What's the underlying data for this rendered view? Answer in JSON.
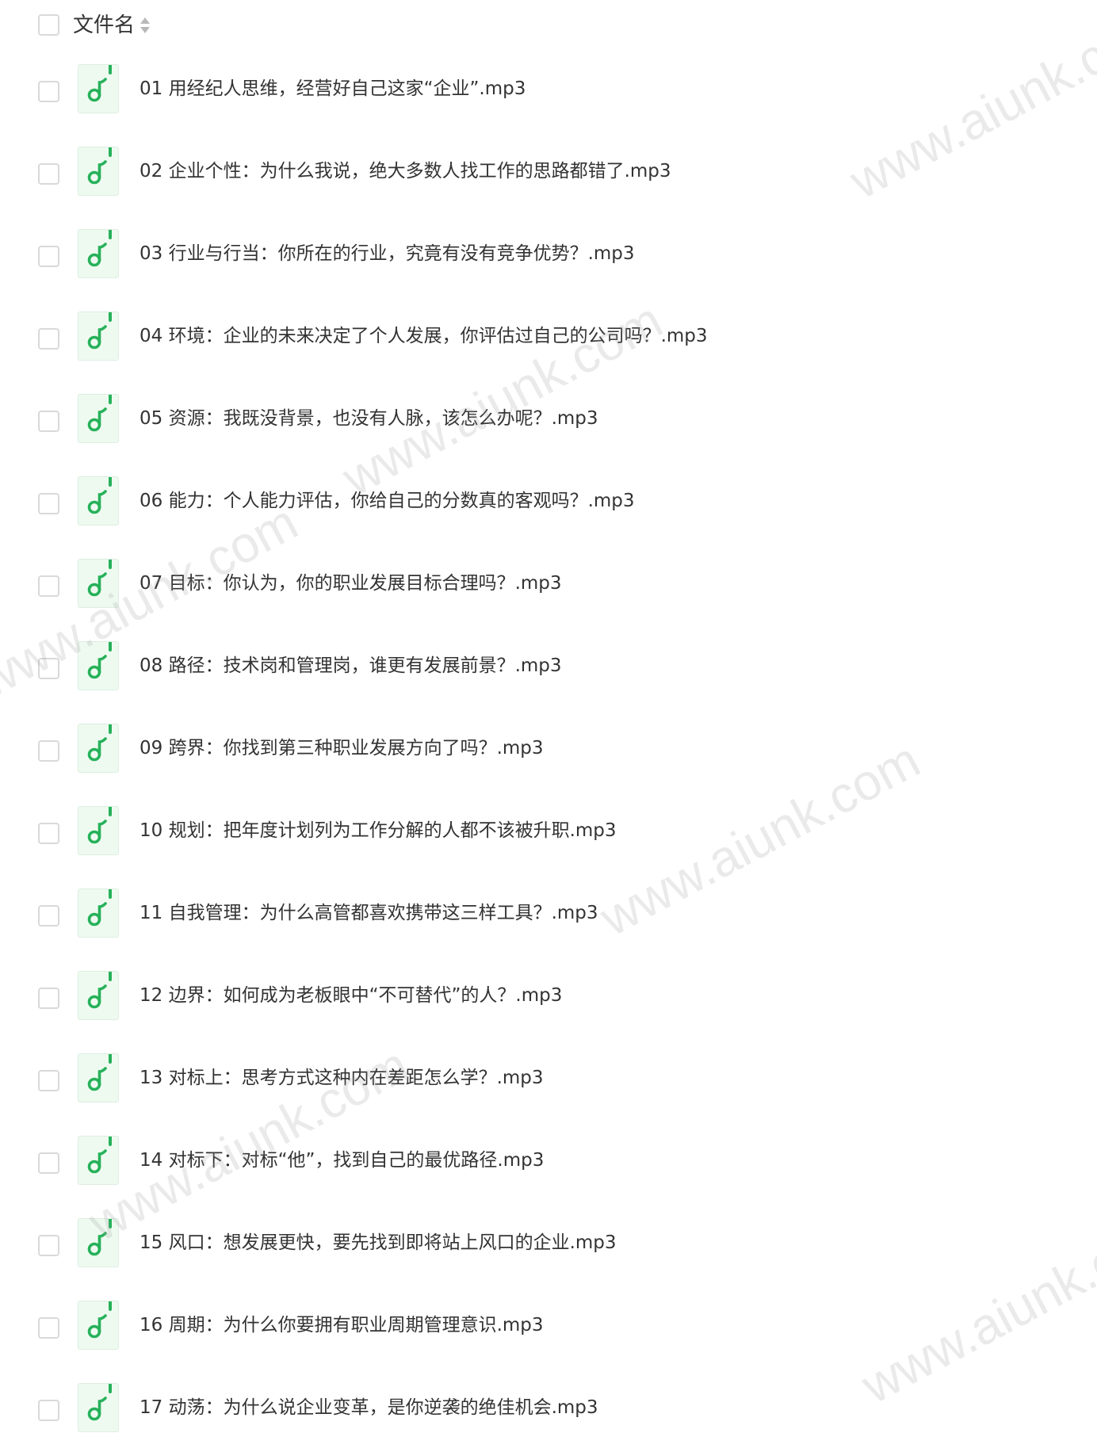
{
  "header": {
    "column_label": "文件名",
    "sort_icon": "sort-icon"
  },
  "file_icon": "music-file-icon",
  "accent_color": "#27b15a",
  "files": [
    {
      "name": "01 用经纪人思维，经营好自己这家“企业”.mp3"
    },
    {
      "name": "02 企业个性：为什么我说，绝大多数人找工作的思路都错了.mp3"
    },
    {
      "name": "03 行业与行当：你所在的行业，究竟有没有竞争优势？.mp3"
    },
    {
      "name": "04 环境：企业的未来决定了个人发展，你评估过自己的公司吗？.mp3"
    },
    {
      "name": "05 资源：我既没背景，也没有人脉，该怎么办呢？.mp3"
    },
    {
      "name": "06 能力：个人能力评估，你给自己的分数真的客观吗？.mp3"
    },
    {
      "name": "07 目标：你认为，你的职业发展目标合理吗？.mp3"
    },
    {
      "name": "08 路径：技术岗和管理岗，谁更有发展前景？.mp3"
    },
    {
      "name": "09 跨界：你找到第三种职业发展方向了吗？.mp3"
    },
    {
      "name": "10 规划：把年度计划列为工作分解的人都不该被升职.mp3"
    },
    {
      "name": "11 自我管理：为什么高管都喜欢携带这三样工具？.mp3"
    },
    {
      "name": "12 边界：如何成为老板眼中“不可替代”的人？.mp3"
    },
    {
      "name": "13 对标上：思考方式这种内在差距怎么学？.mp3"
    },
    {
      "name": "14 对标下：对标“他”，找到自己的最优路径.mp3"
    },
    {
      "name": "15 风口：想发展更快，要先找到即将站上风口的企业.mp3"
    },
    {
      "name": "16 周期：为什么你要拥有职业周期管理意识.mp3"
    },
    {
      "name": "17 动荡：为什么说企业变革，是你逆袭的绝佳机会.mp3"
    }
  ],
  "watermark": {
    "text": "www.aiunk.com"
  }
}
